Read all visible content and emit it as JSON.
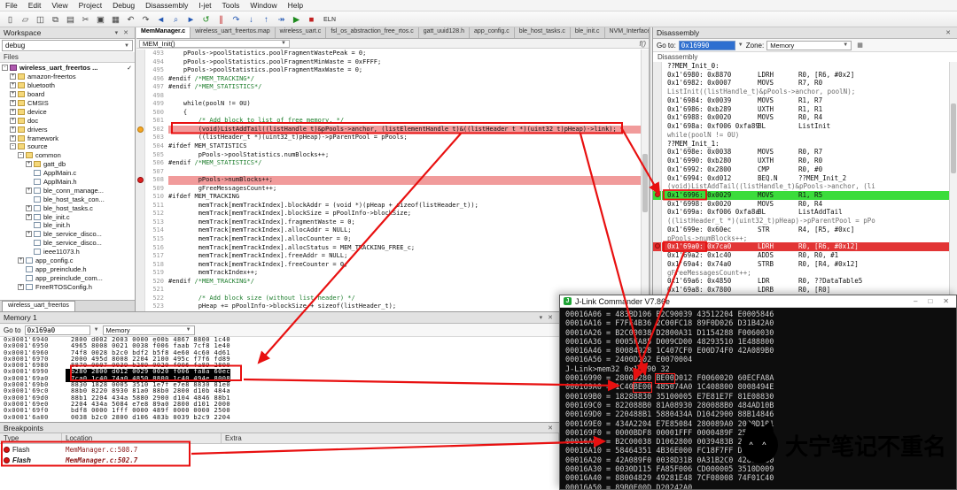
{
  "menu": {
    "items": [
      "File",
      "Edit",
      "View",
      "Project",
      "Debug",
      "Disassembly",
      "I-jet",
      "Tools",
      "Window",
      "Help"
    ]
  },
  "toolbar": {
    "icons": [
      {
        "name": "new-document-icon",
        "g": "▯"
      },
      {
        "name": "open-file-icon",
        "g": "▱"
      },
      {
        "name": "save-icon",
        "g": "◫"
      },
      {
        "name": "save-all-icon",
        "g": "⧉"
      },
      {
        "name": "print-icon",
        "g": "▤"
      },
      {
        "name": "cut-icon",
        "g": "✂"
      },
      {
        "name": "copy-icon",
        "g": "▣"
      },
      {
        "name": "paste-icon",
        "g": "▦"
      },
      {
        "name": "undo-icon",
        "g": "↶"
      },
      {
        "name": "redo-icon",
        "g": "↷"
      },
      {
        "name": "nav-back-icon",
        "g": "◄",
        "c": "cblue"
      },
      {
        "name": "search-icon",
        "g": "⌕",
        "c": "cblue"
      },
      {
        "name": "nav-forward-icon",
        "g": "►",
        "c": "cblue"
      },
      {
        "name": "reset-icon",
        "g": "↺",
        "c": "cgreen"
      },
      {
        "name": "break-icon",
        "g": "∥",
        "c": "cred"
      },
      {
        "name": "step-over-icon",
        "g": "↷",
        "c": "cblue"
      },
      {
        "name": "step-into-icon",
        "g": "↓",
        "c": "cblue"
      },
      {
        "name": "step-out-icon",
        "g": "↑",
        "c": "cblue"
      },
      {
        "name": "run-to-cursor-icon",
        "g": "↠",
        "c": "cblue"
      },
      {
        "name": "go-icon",
        "g": "▶",
        "c": "cgreen"
      },
      {
        "name": "stop-debug-icon",
        "g": "■",
        "c": "cred"
      },
      {
        "name": "eln-indicator",
        "g": "ELN",
        "c": "txt"
      }
    ]
  },
  "workspace": {
    "title": "Workspace",
    "config": "debug",
    "files_header": "Files",
    "bottom_tab": "wireless_uart_freertos",
    "tree": [
      {
        "cls": "d0",
        "exp": "-",
        "icon": "project",
        "label": "wireless_uart_freertos ...",
        "b": "bold",
        "chk": "✓"
      },
      {
        "cls": "d1",
        "exp": "+",
        "icon": "folder",
        "label": "amazon-freertos"
      },
      {
        "cls": "d1",
        "exp": "+",
        "icon": "folder",
        "label": "bluetooth"
      },
      {
        "cls": "d1",
        "exp": "+",
        "icon": "folder",
        "label": "board"
      },
      {
        "cls": "d1",
        "exp": "+",
        "icon": "folder",
        "label": "CMSIS"
      },
      {
        "cls": "d1",
        "exp": "+",
        "icon": "folder",
        "label": "device"
      },
      {
        "cls": "d1",
        "exp": "+",
        "icon": "folder",
        "label": "doc"
      },
      {
        "cls": "d1",
        "exp": "+",
        "icon": "folder",
        "label": "drivers"
      },
      {
        "cls": "d1",
        "exp": "+",
        "icon": "folder",
        "label": "framework"
      },
      {
        "cls": "d1",
        "exp": "-",
        "icon": "folder",
        "label": "source"
      },
      {
        "cls": "d2",
        "exp": "-",
        "icon": "folder",
        "label": "common"
      },
      {
        "cls": "d3",
        "exp": "+",
        "icon": "folder",
        "label": "gatt_db"
      },
      {
        "cls": "d3",
        "icon": "file",
        "label": "ApplMain.c"
      },
      {
        "cls": "d3",
        "icon": "file",
        "label": "ApplMain.h"
      },
      {
        "cls": "d3",
        "exp": "+",
        "icon": "file",
        "label": "ble_conn_manage..."
      },
      {
        "cls": "d3",
        "icon": "file",
        "label": "ble_host_task_con..."
      },
      {
        "cls": "d3",
        "exp": "+",
        "icon": "file",
        "label": "ble_host_tasks.c"
      },
      {
        "cls": "d3",
        "exp": "+",
        "icon": "file",
        "label": "ble_init.c"
      },
      {
        "cls": "d3",
        "icon": "file",
        "label": "ble_init.h"
      },
      {
        "cls": "d3",
        "exp": "+",
        "icon": "file",
        "label": "ble_service_disco..."
      },
      {
        "cls": "d3",
        "icon": "file",
        "label": "ble_service_disco..."
      },
      {
        "cls": "d3",
        "icon": "file",
        "label": "ieee11073.h"
      },
      {
        "cls": "d2",
        "exp": "+",
        "icon": "file",
        "label": "app_config.c"
      },
      {
        "cls": "d2",
        "icon": "file",
        "label": "app_preinclude.h"
      },
      {
        "cls": "d2",
        "icon": "file",
        "label": "app_preinclude_com..."
      },
      {
        "cls": "d2",
        "exp": "+",
        "icon": "file",
        "label": "FreeRTOSConfig.h"
      }
    ]
  },
  "editor": {
    "tabs": [
      {
        "label": "MemManager.c",
        "cls": "active"
      },
      {
        "label": "wireless_uart_freertos.map"
      },
      {
        "label": "wireless_uart.c"
      },
      {
        "label": "fsl_os_abstraction_free_rtos.c"
      },
      {
        "label": "gatt_uuid128.h"
      },
      {
        "label": "app_config.c"
      },
      {
        "label": "ble_host_tasks.c"
      },
      {
        "label": "ble_init.c"
      },
      {
        "label": "NVM_Interface.h"
      }
    ],
    "function_selector": "MEM_Init()",
    "fx_glyph": "f()",
    "lines": [
      {
        "n": 493,
        "code": "    pPools->poolStatistics.poolFragmentWastePeak = 0;"
      },
      {
        "n": 494,
        "code": "    pPools->poolStatistics.poolFragmentMinWaste = 0xFFFF;"
      },
      {
        "n": 495,
        "code": "    pPools->poolStatistics.poolFragmentMaxWaste = 0;"
      },
      {
        "n": 496,
        "code": "#endif ",
        "cm": "/*MEM_TRACKING*/"
      },
      {
        "n": 497,
        "code": "#endif ",
        "cm": "/*MEM_STATISTICS*/"
      },
      {
        "n": 498,
        "code": ""
      },
      {
        "n": 499,
        "code": "    while(poolN != 0U)"
      },
      {
        "n": 500,
        "code": "    {"
      },
      {
        "n": 501,
        "code": "        ",
        "cm": "/* Add block to list of free memory. */"
      },
      {
        "n": 502,
        "code": "        (void)ListAddTail((listHandle_t)&pPools->anchor, (listElementHandle_t)&((listHeader_t *)(uint32_t)pHeap)->link);",
        "cls": "bphl",
        "bp": "orange"
      },
      {
        "n": 503,
        "code": "        ((listHeader_t *)(uint32_t)pHeap)->pParentPool = pPools;"
      },
      {
        "n": 504,
        "code": "#ifdef MEM_STATISTICS"
      },
      {
        "n": 505,
        "code": "        pPools->poolStatistics.numBlocks++;"
      },
      {
        "n": 506,
        "code": "#endif ",
        "cm": "/*MEM_STATISTICS*/"
      },
      {
        "n": 507,
        "code": ""
      },
      {
        "n": 508,
        "code": "        pPools->numBlocks++;",
        "cls": "bphl",
        "bp": "red"
      },
      {
        "n": 509,
        "code": "        gFreeMessagesCount++;"
      },
      {
        "n": 510,
        "code": "#ifdef MEM_TRACKING"
      },
      {
        "n": 511,
        "code": "        memTrack[memTrackIndex].blockAddr = (void *)(pHeap + sizeof(listHeader_t));"
      },
      {
        "n": 512,
        "code": "        memTrack[memTrackIndex].blockSize = pPoolInfo->blockSize;"
      },
      {
        "n": 513,
        "code": "        memTrack[memTrackIndex].fragmentWaste = 0;"
      },
      {
        "n": 514,
        "code": "        memTrack[memTrackIndex].allocAddr = NULL;"
      },
      {
        "n": 515,
        "code": "        memTrack[memTrackIndex].allocCounter = 0;"
      },
      {
        "n": 516,
        "code": "        memTrack[memTrackIndex].allocStatus = MEM_TRACKING_FREE_c;"
      },
      {
        "n": 517,
        "code": "        memTrack[memTrackIndex].freeAddr = NULL;"
      },
      {
        "n": 518,
        "code": "        memTrack[memTrackIndex].freeCounter = 0;"
      },
      {
        "n": 519,
        "code": "        memTrackIndex++;"
      },
      {
        "n": 520,
        "code": "#endif ",
        "cm": "/*MEM_TRACKING*/"
      },
      {
        "n": 521,
        "code": ""
      },
      {
        "n": 522,
        "code": "        ",
        "cm": "/* Add block size (without list header) */"
      },
      {
        "n": 523,
        "code": "        pHeap += pPoolInfo->blockSize + sizeof(listHeader_t);"
      }
    ]
  },
  "disasm": {
    "title": "Disassembly",
    "goto_label": "Go to:",
    "goto_value": "0x16990",
    "zone_label": "Zone:",
    "zone_value": "Memory",
    "inner_title": "Disassembly",
    "lines": [
      {
        "t": "lbl",
        "x": "??MEM_Init_0:"
      },
      {
        "t": "ins",
        "a": "0x1'6980: 0x8870",
        "m": "LDRH",
        "o": "R0, [R6, #0x2]"
      },
      {
        "t": "ins",
        "a": "0x1'6982: 0x0007",
        "m": "MOVS",
        "o": "R7, R0"
      },
      {
        "t": "src",
        "x": "ListInit((listHandle_t)&pPools->anchor, poolN);"
      },
      {
        "t": "ins",
        "a": "0x1'6984: 0x0039",
        "m": "MOVS",
        "o": "R1, R7"
      },
      {
        "t": "ins",
        "a": "0x1'6986: 0xb289",
        "m": "UXTH",
        "o": "R1, R1"
      },
      {
        "t": "ins",
        "a": "0x1'6988: 0x0020",
        "m": "MOVS",
        "o": "R0, R4"
      },
      {
        "t": "ins",
        "a": "0x1'698a: 0xf006 0xfa89",
        "m": "BL",
        "o": "ListInit"
      },
      {
        "t": "src",
        "x": "while(poolN != 0U)"
      },
      {
        "t": "lbl",
        "x": "??MEM_Init_1:"
      },
      {
        "t": "ins",
        "a": "0x1'698e: 0x0038",
        "m": "MOVS",
        "o": "R0, R7"
      },
      {
        "t": "ins",
        "a": "0x1'6990: 0xb280",
        "m": "UXTH",
        "o": "R0, R0"
      },
      {
        "t": "ins",
        "a": "0x1'6992: 0x2800",
        "m": "CMP",
        "o": "R0, #0"
      },
      {
        "t": "ins",
        "a": "0x1'6994: 0xd012",
        "m": "BEQ.N",
        "o": "??MEM_Init_2"
      },
      {
        "t": "src",
        "x": "(void)ListAddTail((listHandle_t)&pPools->anchor, (li"
      },
      {
        "t": "ins",
        "a": "0x1'6996: 0x0029",
        "m": "MOVS",
        "o": "R1, R5",
        "cls": "hl-green",
        "bp": "red"
      },
      {
        "t": "ins",
        "a": "0x1'6998: 0x0020",
        "m": "MOVS",
        "o": "R0, R4"
      },
      {
        "t": "ins",
        "a": "0x1'699a: 0xf006 0xfa8a",
        "m": "BL",
        "o": "ListAddTail"
      },
      {
        "t": "src",
        "x": "((listHeader_t *)(uint32_t)pHeap)->pParentPool = pPo"
      },
      {
        "t": "ins",
        "a": "0x1'699e: 0x60ec",
        "m": "STR",
        "o": "R4, [R5, #0xc]"
      },
      {
        "t": "src",
        "x": "pPools->numBlocks++;"
      },
      {
        "t": "ins",
        "a": "0x1'69a0: 0x7ca0",
        "m": "LDRH",
        "o": "R0, [R6, #0x12]",
        "cls": "hl-red",
        "bp": "red"
      },
      {
        "t": "ins",
        "a": "0x1'69a2: 0x1c40",
        "m": "ADDS",
        "o": "R0, R0, #1"
      },
      {
        "t": "ins",
        "a": "0x1'69a4: 0x74a0",
        "m": "STRB",
        "o": "R0, [R4, #0x12]"
      },
      {
        "t": "src",
        "x": "gFreeMessagesCount++;"
      },
      {
        "t": "ins",
        "a": "0x1'69a6: 0x4850",
        "m": "LDR",
        "o": "R0, ??DataTable5"
      },
      {
        "t": "ins",
        "a": "0x1'69a8: 0x7800",
        "m": "LDRB",
        "o": "R0, [R0]"
      }
    ]
  },
  "memory": {
    "title": "Memory 1",
    "goto_label": "Go to",
    "goto_value": "0x169a0",
    "zone_value": "Memory",
    "rows": [
      {
        "addr": "0x0001'6940",
        "hex": "2800 d002 2003 0000 e00b 4867 8800 1c40"
      },
      {
        "addr": "0x0001'6950",
        "hex": "4965 8008 0021 0038 f006 faab 7cf8 1e40"
      },
      {
        "addr": "0x0001'6960",
        "hex": "74f8 0028 b2c0 bdf2 b5f8 4e60 4c60 4d61"
      },
      {
        "addr": "0x0001'6970",
        "hex": "2000 495d 8008 2204 2100 495c f7f6 fd89"
      },
      {
        "addr": "0x0001'6980",
        "hex": "8870 0007 0039 b289 0020 f006 fa89 2800"
      },
      {
        "addr": "0x0001'6990",
        "hex": "b280 2800 d012 0029 0020 f006 fa8a 60ec",
        "cls": "sel"
      },
      {
        "addr": "0x0001'69a0",
        "hex": "7ca0 1c40 74a0 4850 8800 1c40 494e 8008",
        "cls": "sel"
      },
      {
        "addr": "0x0001'69b0",
        "hex": "8830 1828 0005 3510 1e7f e7e8 8830 81e0"
      },
      {
        "addr": "0x0001'69c0",
        "hex": "88b0 8220 8930 81a0 88b0 2800 d10b 484a"
      },
      {
        "addr": "0x0001'69d0",
        "hex": "88b1 2204 434a 5880 2900 d104 4846 88b1"
      },
      {
        "addr": "0x0001'69e0",
        "hex": "2204 434a 5084 e7e8 89a0 2800 d101 2000"
      },
      {
        "addr": "0x0001'69f0",
        "hex": "bdf8 0000 1fff 0000 489f 0000 0000 2500"
      },
      {
        "addr": "0x0001'6a00",
        "hex": "0038 b2c0 2800 d106 483b 0039 b2c9 2204"
      }
    ]
  },
  "breakpoints": {
    "title": "Breakpoints",
    "columns": [
      "Type",
      "Location",
      "Extra"
    ],
    "rows": [
      {
        "type": "Flash",
        "loc": "MemManager.c:508.7"
      },
      {
        "type": "Flash",
        "loc": "MemManager.c:502.7",
        "cls": "it"
      }
    ]
  },
  "jlink": {
    "title": "J-Link Commander V7.86e",
    "lines": [
      {
        "pre": "00016A06 = 483BD106 B2C90039 43512204 E0005846"
      },
      {
        "pre": "00016A16 = F7FF4B36 2C00FC18 89F0D026 D31B42A0"
      },
      {
        "pre": "00016A26 = B2C00038 D2800A31 D1154288 F0060030"
      },
      {
        "pre": "00016A36 = 0005FA85 D009CD00 48293510 1E488800"
      },
      {
        "pre": "00016A46 = 80084928 1C407CF0 E00D74F0 42A089B0"
      },
      {
        "pre": "00016A56 = 2400D202 E0070004"
      },
      {
        "pre": "J-Link>mem32 0x16990 32"
      },
      {
        "pre": "00016990 = 2800B280 ",
        "box": "BE00",
        "post": "D012 F0060020 60ECFA8A"
      },
      {
        "pre": "000169A0 = 1C40",
        "box": "BE00",
        "post": " 485074A0 1C408800 8008494E"
      },
      {
        "pre": "000169B0 = 18288830 35100005 E7E81E7F 81E08830"
      },
      {
        "pre": "000169C0 = 822088B0 81A08930 280088B0 484AD10B"
      },
      {
        "pre": "000169D0 = 220488B1 5880434A D1042900 88B14846"
      },
      {
        "pre": "000169E0 = 434A2204 E7E85084 280089A0 2000D101"
      },
      {
        "pre": "000169F0 = 0000BDF8 00001FFF 0000489F 25000000"
      },
      {
        "pre": "00016A00 = B2C00038 D1062800 0039483B 2204B2C9"
      },
      {
        "pre": "00016A10 = 58464351 4B36E000 FC18F7FF D0262C00"
      },
      {
        "pre": "00016A20 = 42A089F0 0038D31B 0A31B2C0 4288D280"
      },
      {
        "pre": "00016A30 = 0030D115 FA85F006 CD000005 3510D009"
      },
      {
        "pre": "00016A40 = 88004829 49281E48 7CF08008 74F01C40"
      },
      {
        "pre": "00016A50 = 89B0E00D D20242A0"
      }
    ]
  },
  "watermark": {
    "text": "大宁笔记不重名"
  },
  "colors": {
    "annotation_red": "#e81010",
    "disasm_highlight_green": "#3bdc3b",
    "disasm_highlight_red": "#e23535",
    "memory_selection": "#000000",
    "breakpoint_line_bg": "#f19b9b",
    "jlink_bg": "#0d0d0d"
  }
}
